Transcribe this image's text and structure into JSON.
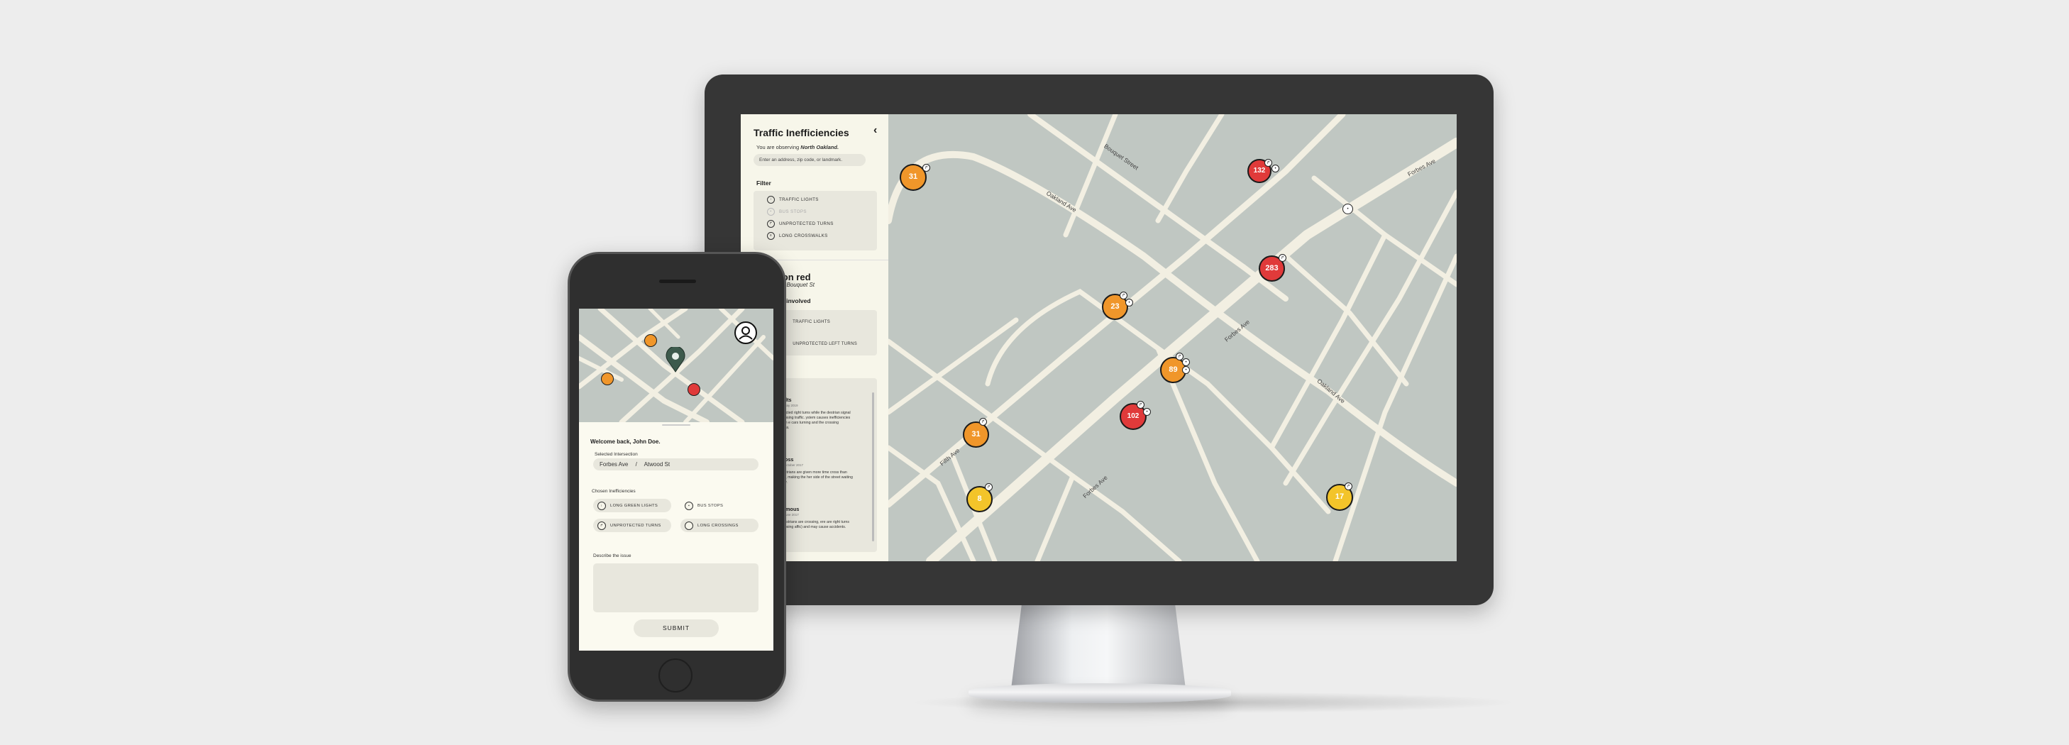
{
  "desktop": {
    "sidebar": {
      "title": "Traffic Inefficiencies",
      "observing_prefix": "You are observing",
      "observing_area": "North Oakland.",
      "search_placeholder": "Enter an address, zip code, or landmark.",
      "filter_label": "Filter",
      "filters": [
        {
          "label": "TRAFFIC LIGHTS",
          "icon": "traffic-light-icon",
          "active": true
        },
        {
          "label": "BUS STOPS",
          "icon": "bus-icon",
          "active": false
        },
        {
          "label": "UNPROTECTED TURNS",
          "icon": "turn-icon",
          "active": true
        },
        {
          "label": "LONG CROSSWALKS",
          "icon": "crosswalk-icon",
          "active": true
        }
      ],
      "incident_title": "ns on red",
      "incident_location": "/ Bouquet St",
      "inefficiencies_label": "ncies involved",
      "inefficiencies": [
        {
          "count": "2",
          "label": "TRAFFIC LIGHTS"
        },
        {
          "count": "4",
          "label": "UNPROTECTED LEFT TURNS"
        }
      ],
      "comments_label": "ts",
      "comments": [
        {
          "name": "ul Wilts",
          "date": "posted May 2019",
          "text": "unprotected right turns while the destrian signal for opposing traffic. ystem causes inefficiencies between e cars turning and the crossing destrians."
        },
        {
          "name": "ck Moss",
          "date": "posted October 2017",
          "text": "e pedestrians are given more time cross than needed, making the her side of the street waiting edlessly."
        },
        {
          "name": "nonymous",
          "date": "posted June 2017",
          "text": "ile pedestrians are crossing, ere are right turns (in opposing affic) and may cause accidents."
        }
      ]
    },
    "map": {
      "streets": [
        "Bouquet Street",
        "Oakland Ave",
        "Forbes Ave",
        "Forbes Ave",
        "Oakland Ave",
        "Fifth Ave",
        "Forbes Ave"
      ],
      "markers": [
        {
          "value": "31",
          "color": "orange"
        },
        {
          "value": "132",
          "color": "red"
        },
        {
          "value": "283",
          "color": "red"
        },
        {
          "value": "23",
          "color": "orange"
        },
        {
          "value": "89",
          "color": "orange"
        },
        {
          "value": "102",
          "color": "red"
        },
        {
          "value": "31",
          "color": "orange"
        },
        {
          "value": "8",
          "color": "yellow"
        },
        {
          "value": "17",
          "color": "yellow"
        }
      ]
    }
  },
  "mobile": {
    "welcome": "Welcome back, John Doe.",
    "selected_label": "Selected Intersection",
    "selected_street_a": "Forbes Ave",
    "selected_sep": "/",
    "selected_street_b": "Atwood St",
    "chosen_label": "Chosen Inefficiencies",
    "chips": [
      {
        "label": "LONG GREEN LIGHTS",
        "icon": "traffic-light-icon"
      },
      {
        "label": "BUS STOPS",
        "icon": "bus-icon"
      },
      {
        "label": "UNPROTECTED TURNS",
        "icon": "turn-icon"
      },
      {
        "label": "LONG CROSSINGS",
        "icon": "crosswalk-icon"
      }
    ],
    "describe_label": "Describe the issue",
    "submit_label": "SUBMIT"
  },
  "colors": {
    "map_land": "#c0c7c2",
    "road": "#f2efe2",
    "panel": "#f7f6ea",
    "marker_orange": "#f0962a",
    "marker_red": "#e03a3a",
    "marker_yellow": "#f3c42a"
  }
}
